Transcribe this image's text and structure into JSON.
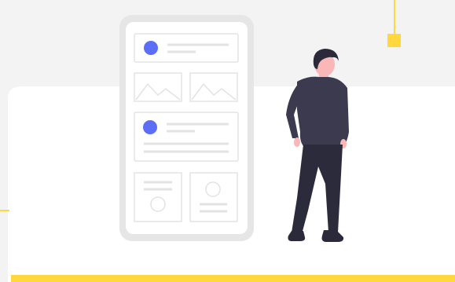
{
  "colors": {
    "background": "#f3f3f3",
    "card": "#ffffff",
    "accent_yellow": "#ffd83d",
    "accent_blue": "#5b6ef5",
    "phone_frame": "#e6e6e6",
    "wireframe_line": "#e3e3e3",
    "skin": "#f9b7b7",
    "hair": "#2b2a3a",
    "shirt": "#3c3a4f",
    "pants": "#2c2b3c",
    "shoes": "#2b2a3a"
  },
  "illustration": {
    "subject": "person-standing-next-to-phone-wireframe",
    "phone_sections": [
      "profile-card",
      "image-placeholders",
      "profile-card-with-text",
      "content-tiles"
    ]
  }
}
